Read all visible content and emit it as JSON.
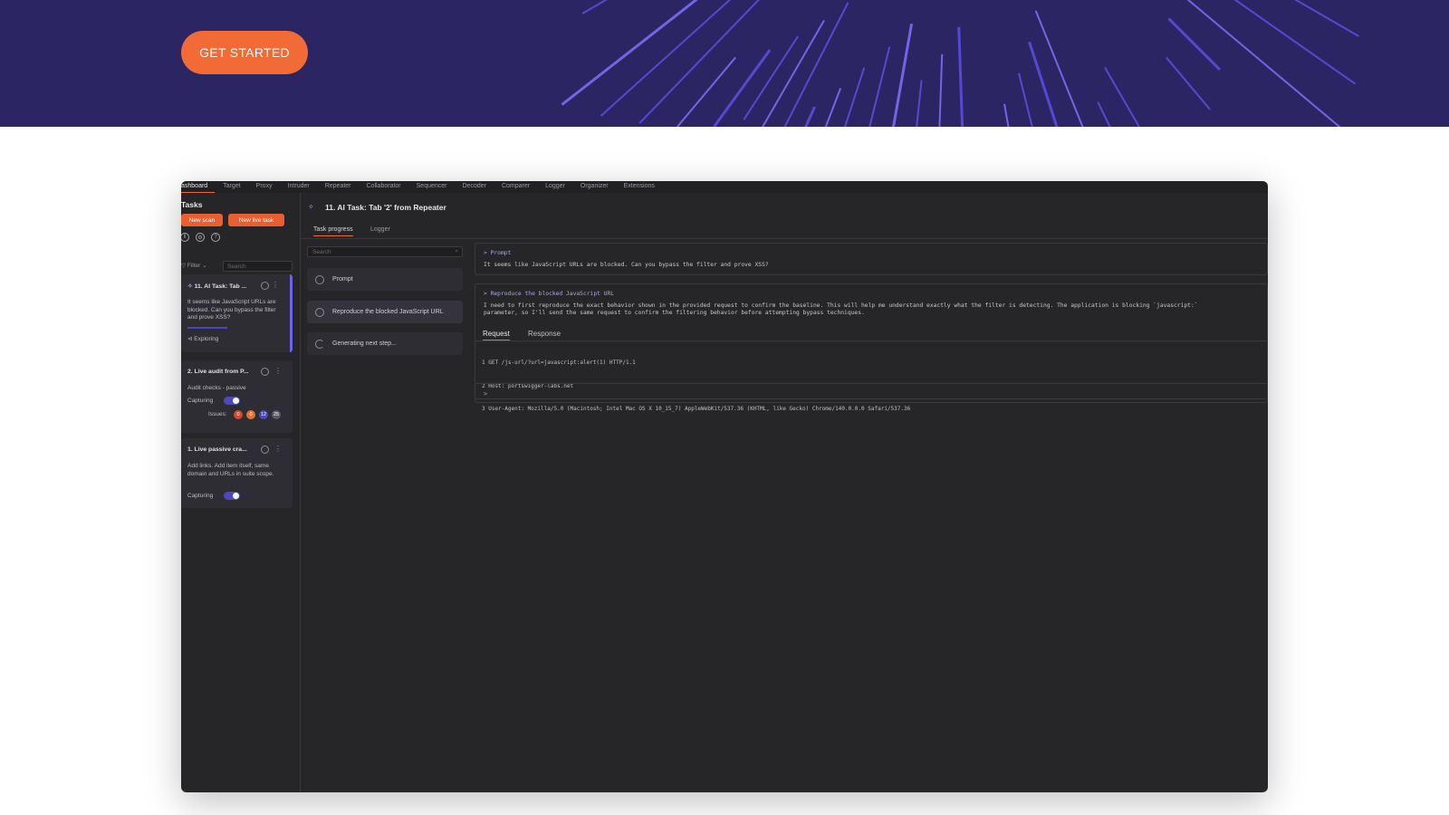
{
  "hero": {
    "cta_label": "GET STARTED",
    "bg_color": "#2b2563",
    "accent": "#f26a36"
  },
  "app": {
    "menu": [
      "ashboard",
      "Target",
      "Proxy",
      "Intruder",
      "Repeater",
      "Collaborator",
      "Sequencer",
      "Decoder",
      "Comparer",
      "Logger",
      "Organizer",
      "Extensions"
    ],
    "tasks_heading": "Tasks",
    "new_scan": "New scan",
    "new_live_task": "New live task",
    "filter": "Filter",
    "search_placeholder": "Search",
    "cards": [
      {
        "title": "11. AI Task: Tab ...",
        "desc": "It seems like JavaScript URLs are blocked. Can you bypass the filter and prove XSS?",
        "status": "Exploring"
      },
      {
        "title": "2. Live audit from P...",
        "desc": "Audit checks - passive",
        "capturing": "Capturing",
        "issues_label": "Issues:",
        "badges": [
          "0",
          "0",
          "12",
          "25"
        ]
      },
      {
        "title": "1. Live passive cra...",
        "desc": "Add links. Add item itself, same domain and URLs in suite scope.",
        "capturing": "Capturing"
      }
    ],
    "task_title": "11. AI Task: Tab '2' from Repeater",
    "tabs": [
      "Task progress",
      "Logger"
    ],
    "steps": [
      "Prompt",
      "Reproduce the blocked JavaScript URL",
      "Generating next step..."
    ],
    "prompt_block": {
      "heading": "> Prompt",
      "text": "It seems like JavaScript URLs are blocked. Can you bypass the filter and prove XSS?"
    },
    "repro_block": {
      "heading": "> Reproduce the blocked JavaScript URL",
      "line1": "I need to first reproduce the exact behavior shown in the provided request to confirm the baseline. This will help me understand exactly what the filter is detecting. The application is blocking `javascript:`",
      "line2": "parameter, so I'll send the same request to confirm the filtering behavior before attempting bypass techniques."
    },
    "req_tabs": [
      "Request",
      "Response"
    ],
    "request_lines": [
      "1 GET /js-url/?url=javascript:alert(1) HTTP/1.1",
      "2 Host: portswigger-labs.net",
      "3 User-Agent: Mozilla/5.0 (Macintosh; Intel Mac OS X 10_15_7) AppleWebKit/537.36 (KHTML, like Gecko) Chrome/140.0.0.0 Safari/537.36"
    ],
    "prompt_caret": ">"
  }
}
